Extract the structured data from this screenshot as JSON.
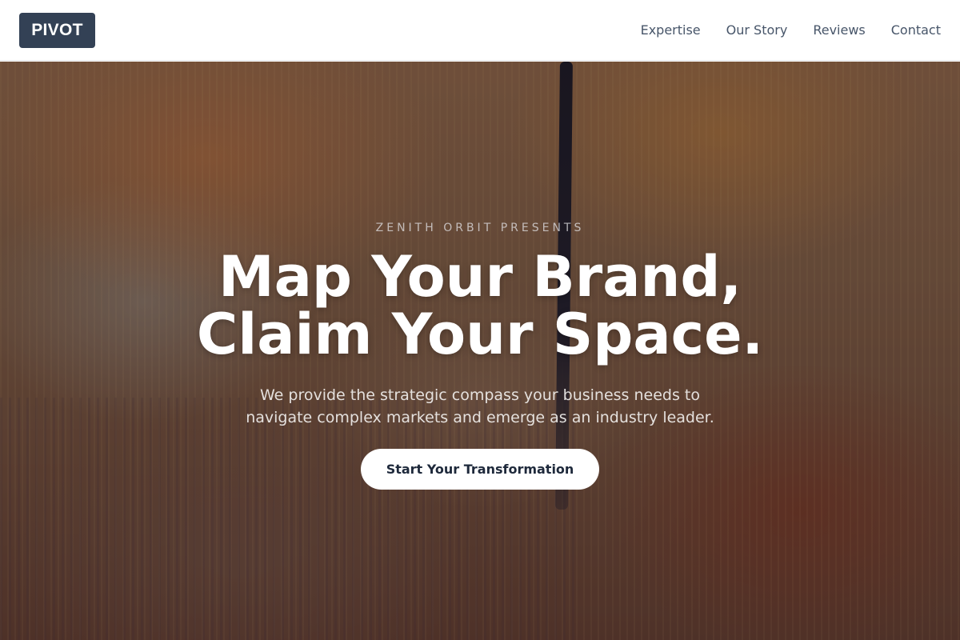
{
  "header": {
    "logo_text": "PIVOT",
    "nav": [
      {
        "label": "Expertise"
      },
      {
        "label": "Our Story"
      },
      {
        "label": "Reviews"
      },
      {
        "label": "Contact"
      }
    ]
  },
  "hero": {
    "eyebrow": "ZENITH ORBIT PRESENTS",
    "headline_line1": "Map Your Brand,",
    "headline_line2": "Claim Your Space.",
    "subtext_line1": "We provide the strategic compass your business needs to",
    "subtext_line2": "navigate complex markets and emerge as an industry leader.",
    "cta_label": "Start Your Transformation",
    "background_image": "textured-oil-painting"
  },
  "colors": {
    "logo_bg": "#334155",
    "nav_text": "#475569",
    "cta_bg": "#ffffff",
    "cta_text": "#1e293b"
  }
}
